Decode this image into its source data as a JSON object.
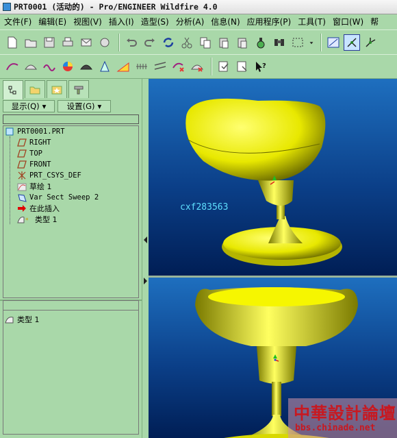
{
  "window": {
    "title": "PRT0001 (活动的) - Pro/ENGINEER Wildfire 4.0"
  },
  "menu": [
    {
      "label": "文件(F)"
    },
    {
      "label": "编辑(E)"
    },
    {
      "label": "视图(V)"
    },
    {
      "label": "插入(I)"
    },
    {
      "label": "造型(S)"
    },
    {
      "label": "分析(A)"
    },
    {
      "label": "信息(N)"
    },
    {
      "label": "应用程序(P)"
    },
    {
      "label": "工具(T)"
    },
    {
      "label": "窗口(W)"
    },
    {
      "label": "帮"
    }
  ],
  "sidebar": {
    "show_label": "显示(Q)",
    "settings_label": "设置(G)",
    "tree": [
      {
        "label": "PRT0001.PRT",
        "icon": "part-icon"
      },
      {
        "label": "RIGHT",
        "icon": "datum-plane-icon"
      },
      {
        "label": "TOP",
        "icon": "datum-plane-icon"
      },
      {
        "label": "FRONT",
        "icon": "datum-plane-icon"
      },
      {
        "label": "PRT_CSYS_DEF",
        "icon": "csys-icon"
      },
      {
        "label": "草绘 1",
        "icon": "sketch-icon"
      },
      {
        "label": "Var Sect Sweep 2",
        "icon": "sweep-icon"
      },
      {
        "label": "在此插入",
        "icon": "insert-here-icon"
      },
      {
        "label": "类型 1",
        "icon": "style-icon"
      }
    ],
    "bottom_item": {
      "label": "类型 1",
      "icon": "style-icon"
    }
  },
  "viewport": {
    "label": "cxf283563"
  },
  "watermark": {
    "title": "中華設計論壇",
    "url": "bbs.chinade.net"
  },
  "colors": {
    "panel_bg": "#a9d8a9",
    "model_yellow": "#e8e800",
    "viewport_top": "#1e6fbf",
    "viewport_bottom": "#001e55"
  }
}
